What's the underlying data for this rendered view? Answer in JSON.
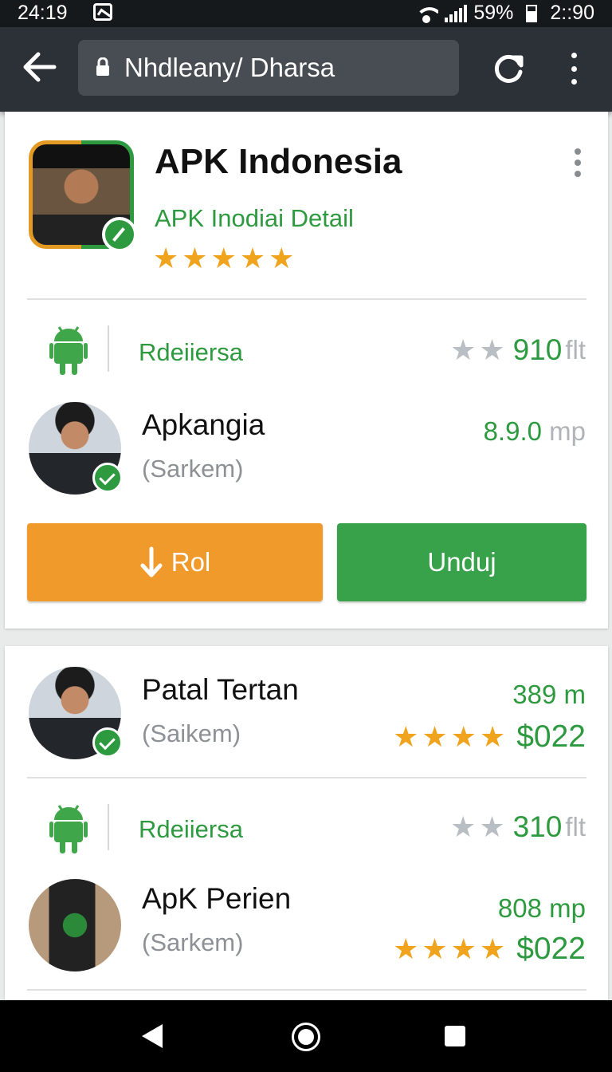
{
  "status_bar": {
    "time_left": "24:19",
    "battery": "59%",
    "time_right": "2::90"
  },
  "toolbar": {
    "url": "Nhdleany/ Dharsa"
  },
  "app": {
    "title": "APK Indonesia",
    "subtitle": "APK Inodiai Detail",
    "rating_stars": 5
  },
  "card1": {
    "row1": {
      "dev_name": "Rdeiiersa",
      "stars_grey": 2,
      "value": "910",
      "unit": "flt"
    },
    "person": {
      "name": "Apkangia",
      "sub": "(Sarkem)",
      "value": "8.9.0",
      "unit": "mp"
    },
    "buttons": {
      "left_label": "Rol",
      "right_label": "Unduj"
    }
  },
  "card2": {
    "person1": {
      "name": "Patal Tertan",
      "sub": "(Saikem)",
      "value": "389",
      "unit": "m",
      "stars": 4,
      "price": "$022"
    },
    "row2": {
      "dev_name": "Rdeiiersa",
      "stars_grey": 2,
      "value": "310",
      "unit": "flt"
    },
    "person2": {
      "name": "ApK Perien",
      "sub": "(Sarkem)",
      "value": "808",
      "unit": "mp",
      "stars": 4,
      "price": "$022"
    }
  },
  "colors": {
    "green": "#2e9a3f",
    "orange": "#f19a2c",
    "gold_star": "#f0a31c",
    "toolbar": "#2c3137"
  },
  "icons": [
    "back-arrow-icon",
    "lock-icon",
    "reload-icon",
    "more-vert-icon",
    "android-icon",
    "check-badge-icon",
    "download-arrow-icon",
    "nav-back-icon",
    "nav-home-icon",
    "nav-recents-icon"
  ]
}
